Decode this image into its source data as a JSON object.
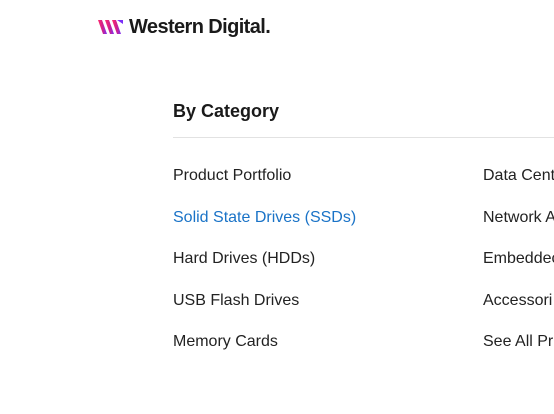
{
  "brand": {
    "name": "Western Digital.",
    "mark_colors": [
      "#e8175d",
      "#8a2be2"
    ]
  },
  "category_section": {
    "heading": "By Category"
  },
  "categories_left": [
    {
      "label": "Product Portfolio",
      "active": false
    },
    {
      "label": "Solid State Drives (SSDs)",
      "active": true
    },
    {
      "label": "Hard Drives (HDDs)",
      "active": false
    },
    {
      "label": "USB Flash Drives",
      "active": false
    },
    {
      "label": "Memory Cards",
      "active": false
    }
  ],
  "categories_right": [
    {
      "label": "Data Cent"
    },
    {
      "label": "Network A"
    },
    {
      "label": "Embeddec"
    },
    {
      "label": "Accessori"
    },
    {
      "label": "See All Pr"
    }
  ],
  "colors": {
    "link": "#222222",
    "link_active": "#1a73c7",
    "divider": "#e2e2e2"
  }
}
